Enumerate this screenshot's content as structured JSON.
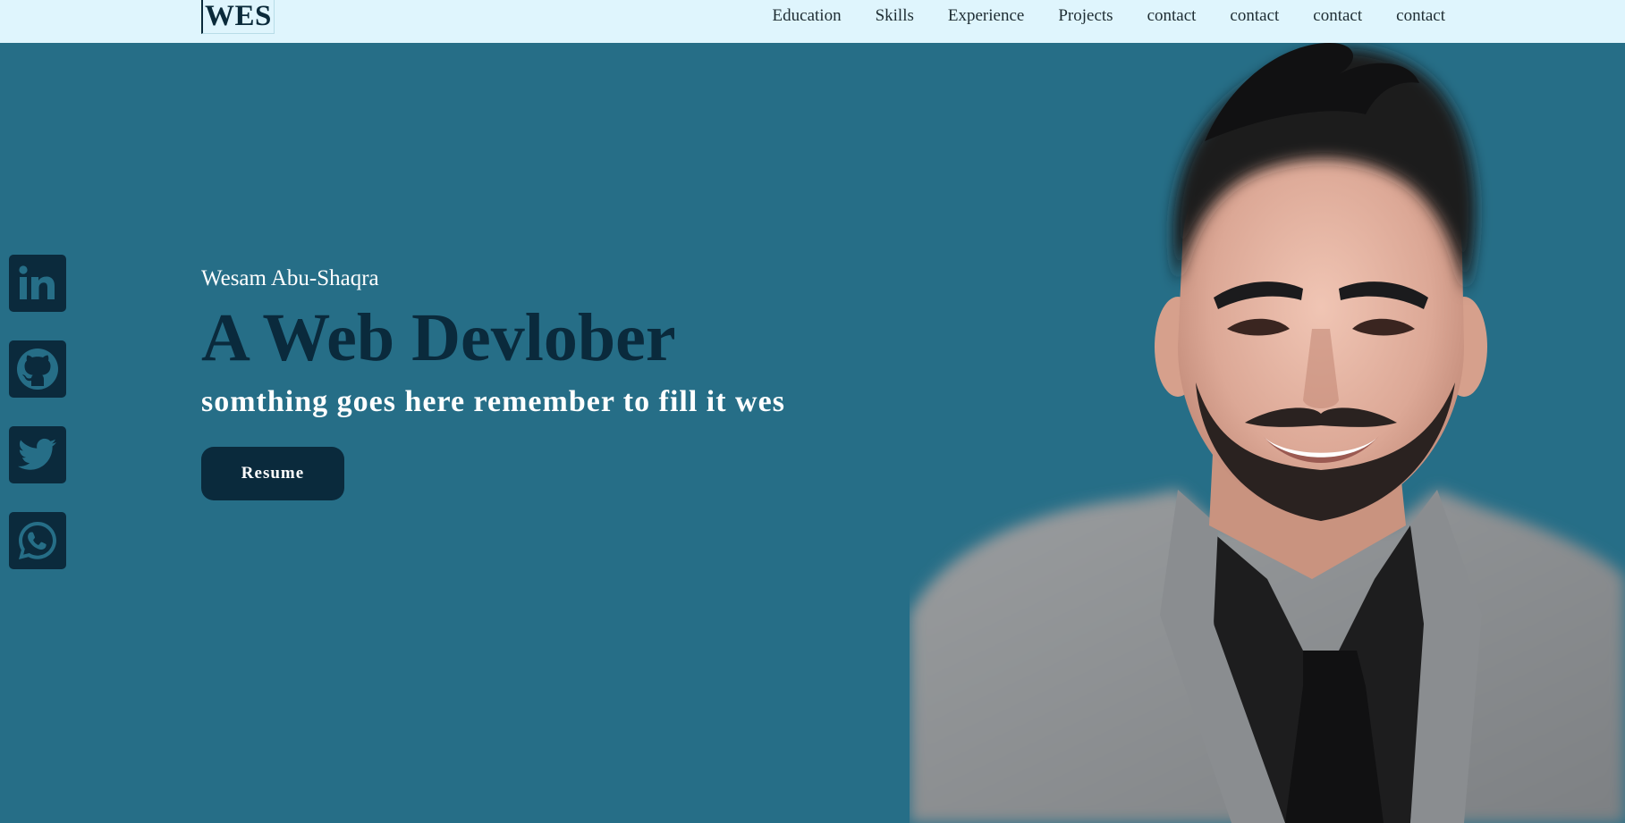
{
  "navbar": {
    "logo": "WES",
    "links": [
      "Education",
      "Skills",
      "Experience",
      "Projects",
      "contact",
      "contact",
      "contact",
      "contact"
    ]
  },
  "social": {
    "icons": [
      "linkedin-icon",
      "github-icon",
      "twitter-icon",
      "whatsapp-icon"
    ]
  },
  "hero": {
    "name": "Wesam Abu-Shaqra",
    "title": "A Web Devlober",
    "subtitle": "somthing goes here remember to fill it wes",
    "resume_label": "Resume"
  },
  "colors": {
    "background": "#266e87",
    "navbar": "#dff5fd",
    "dark": "#0a2a3c",
    "text_light": "#ffffff"
  }
}
